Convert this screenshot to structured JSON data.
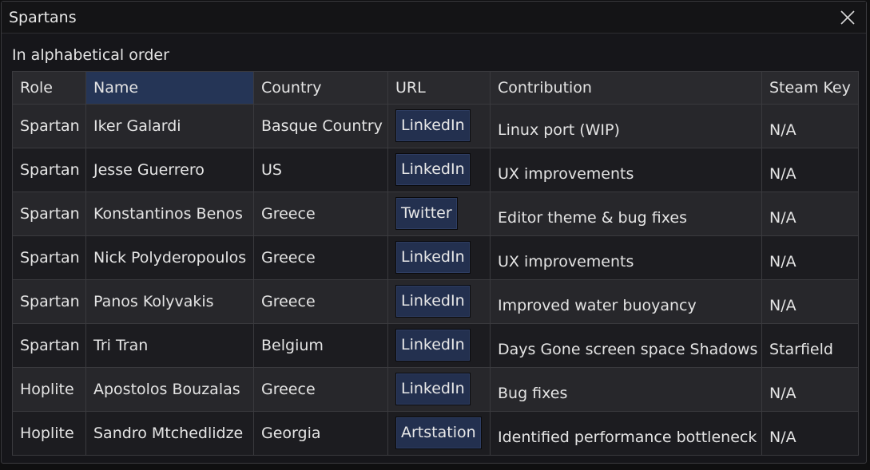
{
  "window": {
    "title": "Spartans"
  },
  "subtitle": "In alphabetical order",
  "columns": [
    "Role",
    "Name",
    "Country",
    "URL",
    "Contribution",
    "Steam Key"
  ],
  "rows": [
    {
      "role": "Spartan",
      "name": "Iker Galardi",
      "country": "Basque Country",
      "url": "LinkedIn",
      "contribution": "Linux port (WIP)",
      "steam_key": "N/A"
    },
    {
      "role": "Spartan",
      "name": "Jesse Guerrero",
      "country": "US",
      "url": "LinkedIn",
      "contribution": "UX improvements",
      "steam_key": "N/A"
    },
    {
      "role": "Spartan",
      "name": "Konstantinos Benos",
      "country": "Greece",
      "url": "Twitter",
      "contribution": "Editor theme & bug fixes",
      "steam_key": "N/A"
    },
    {
      "role": "Spartan",
      "name": "Nick Polyderopoulos",
      "country": "Greece",
      "url": "LinkedIn",
      "contribution": "UX improvements",
      "steam_key": "N/A"
    },
    {
      "role": "Spartan",
      "name": "Panos Kolyvakis",
      "country": "Greece",
      "url": "LinkedIn",
      "contribution": "Improved water buoyancy",
      "steam_key": "N/A"
    },
    {
      "role": "Spartan",
      "name": "Tri Tran",
      "country": "Belgium",
      "url": "LinkedIn",
      "contribution": "Days Gone screen space Shadows",
      "steam_key": "Starfield"
    },
    {
      "role": "Hoplite",
      "name": "Apostolos Bouzalas",
      "country": "Greece",
      "url": "LinkedIn",
      "contribution": "Bug fixes",
      "steam_key": "N/A"
    },
    {
      "role": "Hoplite",
      "name": "Sandro Mtchedlidze",
      "country": "Georgia",
      "url": "Artstation",
      "contribution": "Identified performance bottleneck",
      "steam_key": "N/A"
    }
  ],
  "icons": {
    "close": "close-icon"
  },
  "colors": {
    "selected_header": "#253556",
    "link_button": "#23304f"
  }
}
